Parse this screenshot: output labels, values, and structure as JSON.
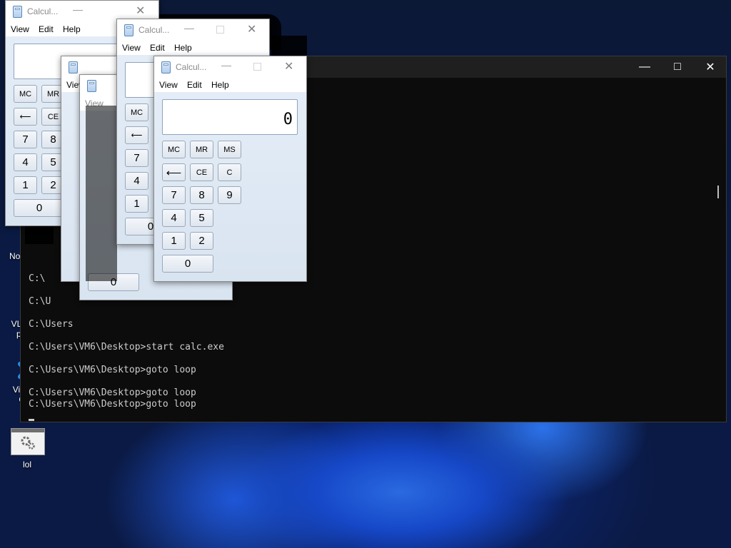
{
  "desktop": {
    "icons": [
      {
        "label": "Notep...",
        "icon": "notepad-icon"
      },
      {
        "label": "VLC media player",
        "label_line1": "VLC m",
        "label_line2": "play",
        "icon": "vlc-icon"
      },
      {
        "label": "Visual Studio Code",
        "label_line1": "Visual",
        "label_line2": "Co",
        "icon": "vscode-icon"
      },
      {
        "label": "lol",
        "icon": "batch-file-icon"
      }
    ]
  },
  "terminal": {
    "controls": {
      "minimize": "—",
      "maximize": "□",
      "close": "✕"
    },
    "lines": [
      "C:\\",
      "C:\\U",
      "C:\\Users",
      "C:\\Users\\VM6\\Desktop>start calc.exe",
      "C:\\Users\\VM6\\Desktop>goto loop",
      "C:\\Users\\VM6\\Desktop>goto loop",
      "C:\\Users\\VM6\\Desktop>goto loop"
    ]
  },
  "calculator": {
    "title": "Calcul...",
    "menu": {
      "view": "View",
      "edit": "Edit",
      "help": "Help"
    },
    "display_value": "0",
    "keys": {
      "mc": "MC",
      "mr": "MR",
      "ms": "MS",
      "backspace": "⟵",
      "ce": "CE",
      "c": "C",
      "seven": "7",
      "eight": "8",
      "nine": "9",
      "four": "4",
      "five": "5",
      "one": "1",
      "two": "2",
      "zero": "0"
    }
  },
  "colors": {
    "terminal_bg": "#0c0c0c",
    "terminal_text": "#cccccc",
    "calc_body": "#dde7f3",
    "desktop_accent": "#1f57d8"
  }
}
